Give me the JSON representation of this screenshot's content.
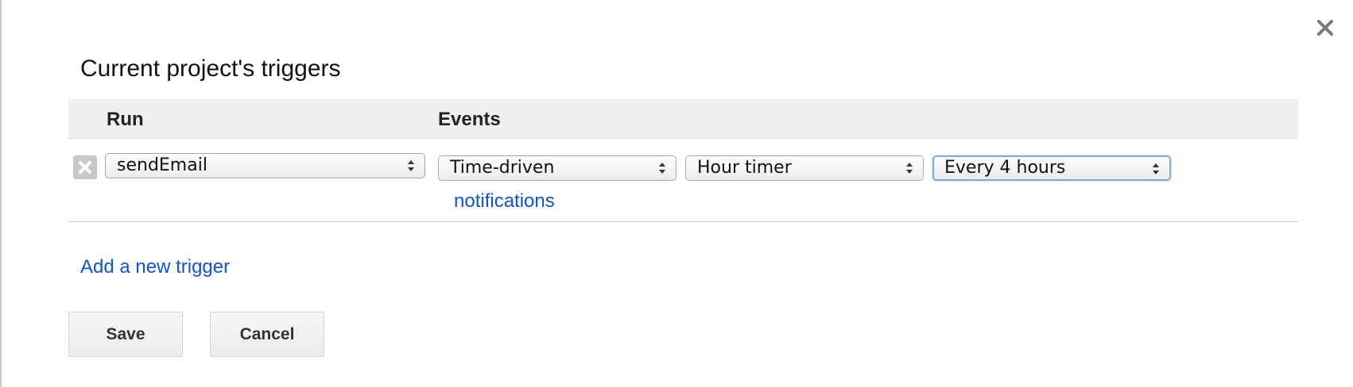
{
  "dialog": {
    "title": "Current project's triggers",
    "close_icon": "close-icon"
  },
  "table": {
    "headers": {
      "run": "Run",
      "events": "Events"
    },
    "rows": [
      {
        "function": "sendEmail",
        "event_source": "Time-driven",
        "event_type": "Hour timer",
        "interval": "Every 4 hours",
        "notifications_link": "notifications"
      }
    ]
  },
  "add_trigger_link": "Add a new trigger",
  "buttons": {
    "save": "Save",
    "cancel": "Cancel"
  },
  "colors": {
    "link": "#1155cc",
    "header_bg": "#efefef",
    "focus": "#7ea8e6"
  }
}
